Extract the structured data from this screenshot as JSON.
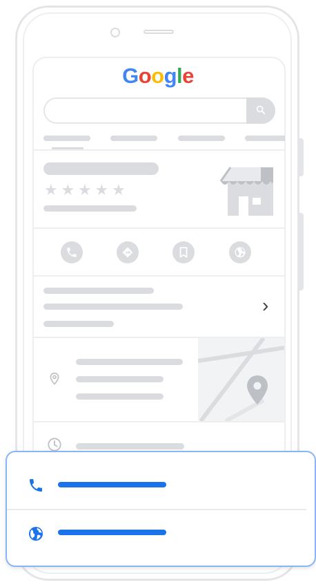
{
  "brand": {
    "logo_letters": [
      {
        "char": "G",
        "color": "#4285F4"
      },
      {
        "char": "o",
        "color": "#EA4335"
      },
      {
        "char": "o",
        "color": "#FBBC05"
      },
      {
        "char": "g",
        "color": "#4285F4"
      },
      {
        "char": "l",
        "color": "#34A853"
      },
      {
        "char": "e",
        "color": "#EA4335"
      }
    ]
  },
  "listing": {
    "rating_stars": 5,
    "star_glyph": "★"
  },
  "details_row": {
    "chevron": "›"
  },
  "colors": {
    "placeholder": "#dadce0",
    "accent": "#1a73e8",
    "card_border": "#8ab4f8"
  },
  "icons": {
    "search": "search-icon",
    "phone": "phone-icon",
    "directions": "directions-icon",
    "save": "bookmark-icon",
    "website": "globe-icon",
    "location": "location-pin-icon",
    "hours": "clock-icon",
    "storefront": "storefront-icon"
  }
}
